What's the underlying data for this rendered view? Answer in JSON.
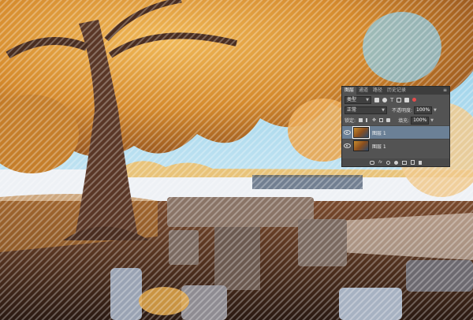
{
  "panel": {
    "tabs": [
      "图层",
      "通道",
      "路径",
      "历史记录"
    ],
    "active_tab": "图层",
    "kind_filter": "类型",
    "blend_mode": "正常",
    "opacity_label": "不透明度:",
    "opacity_value": "100%",
    "lock_label": "锁定:",
    "fill_label": "填充:",
    "fill_value": "100%",
    "layers": [
      {
        "name": "图层 1",
        "selected": true
      },
      {
        "name": "图层 1",
        "selected": false
      }
    ],
    "menu_glyph": "≡"
  },
  "icons": {
    "panel_menu": "menu-icon",
    "filter": [
      "pixel-filter-icon",
      "adjustment-filter-icon",
      "type-filter-icon",
      "shape-filter-icon",
      "smart-object-filter-icon",
      "filter-toggle-icon"
    ],
    "locks": [
      "lock-transparent-icon",
      "lock-paint-icon",
      "lock-position-icon",
      "lock-artboard-icon",
      "lock-all-icon"
    ],
    "bottom": [
      "link-layers-icon",
      "fx-icon",
      "mask-icon",
      "adjustment-layer-icon",
      "group-icon",
      "new-layer-icon",
      "trash-icon"
    ]
  },
  "colors": {
    "panel_bg": "#535353",
    "selected_layer": "#6b8096",
    "foliage": "#d9902f",
    "sky": "#9fd3ea"
  }
}
